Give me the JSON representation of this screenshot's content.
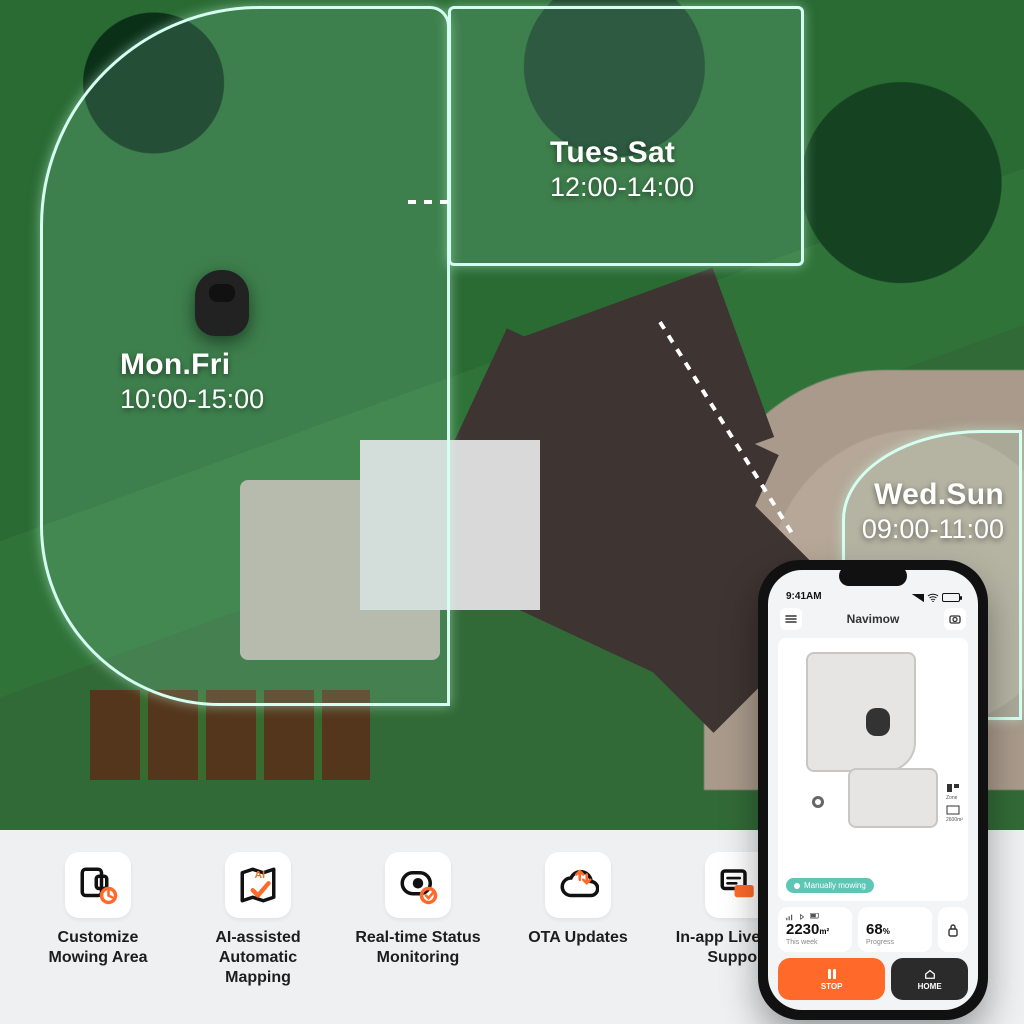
{
  "zones": [
    {
      "days": "Mon.Fri",
      "time": "10:00-15:00"
    },
    {
      "days": "Tues.Sat",
      "time": "12:00-14:00"
    },
    {
      "days": "Wed.Sun",
      "time": "09:00-11:00"
    }
  ],
  "features": [
    {
      "label": "Customize Mowing Area"
    },
    {
      "label": "AI-assisted Automatic Mapping"
    },
    {
      "label": "Real-time Status Monitoring"
    },
    {
      "label": "OTA Updates"
    },
    {
      "label": "In-app Live Chat Support"
    }
  ],
  "phone": {
    "status_time": "9:41AM",
    "app_title": "Navimow",
    "status_pill": "Manually mowing",
    "stat_area_value": "2230",
    "stat_area_unit": "m²",
    "stat_area_sub": "This week",
    "stat_progress_value": "68",
    "stat_progress_unit": "%",
    "stat_progress_sub": "Progress",
    "side_zone": "Zone",
    "side_area": "2600m²",
    "btn_stop": "STOP",
    "btn_home": "HOME"
  },
  "colors": {
    "accent": "#ff6a2b",
    "zone_outline": "#d4fff1"
  }
}
